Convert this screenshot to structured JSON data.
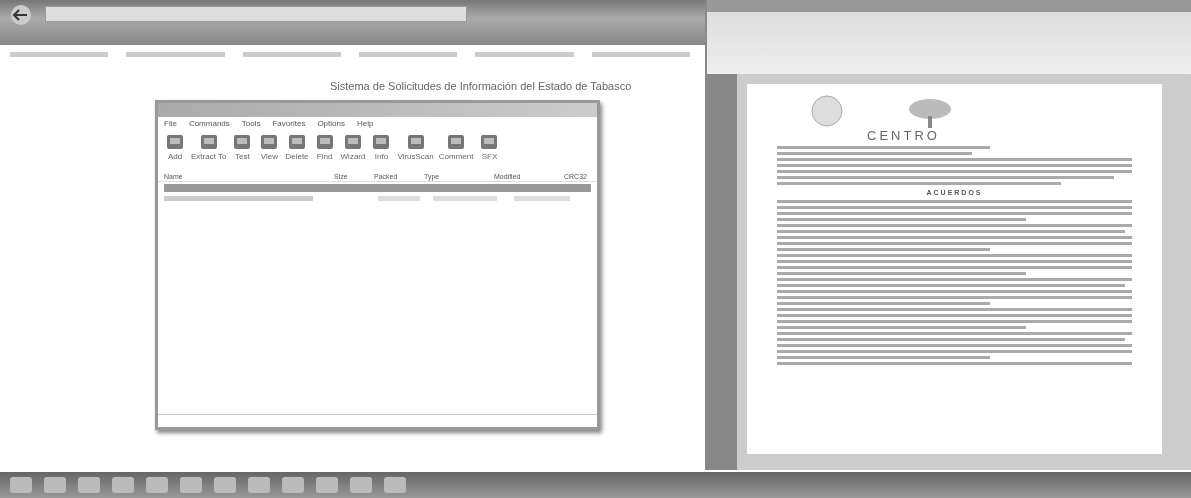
{
  "browser": {
    "page_heading": "Sistema de Solicitudes de Información del Estado de Tabasco"
  },
  "archive_window": {
    "menu": [
      "File",
      "Commands",
      "Tools",
      "Favorites",
      "Options",
      "Help"
    ],
    "toolbar": [
      "Add",
      "Extract To",
      "Test",
      "View",
      "Delete",
      "Find",
      "Wizard",
      "Info",
      "VirusScan",
      "Comment",
      "SFX"
    ],
    "columns": [
      "Name",
      "Size",
      "Packed",
      "Type",
      "Modified",
      "CRC32"
    ],
    "rows": [
      {
        "kind": "parent",
        "selected": true
      },
      {
        "kind": "file",
        "selected": false
      }
    ]
  },
  "pdf_viewer": {
    "logo_text": "CENTRO",
    "heading": "ACUERDOS"
  }
}
